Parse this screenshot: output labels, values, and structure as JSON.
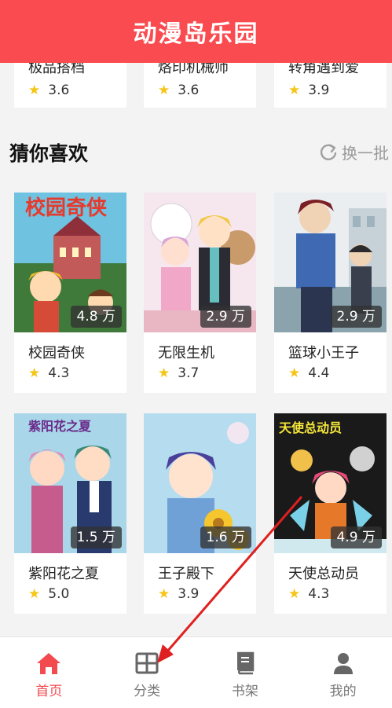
{
  "header": {
    "title": "动漫岛乐园"
  },
  "top_row": [
    {
      "name": "极品搭档",
      "rating": "3.6"
    },
    {
      "name": "烙印机械师",
      "rating": "3.6"
    },
    {
      "name": "转角遇到爱",
      "rating": "3.9"
    }
  ],
  "section": {
    "title": "猜你喜欢",
    "refresh_label": "换一批"
  },
  "comics": [
    {
      "name": "校园奇侠",
      "rating": "4.3",
      "views": "4.8 万"
    },
    {
      "name": "无限生机",
      "rating": "3.7",
      "views": "2.9 万"
    },
    {
      "name": "篮球小王子",
      "rating": "4.4",
      "views": "2.9 万"
    },
    {
      "name": "紫阳花之夏",
      "rating": "5.0",
      "views": "1.5 万"
    },
    {
      "name": "王子殿下",
      "rating": "3.9",
      "views": "1.6 万"
    },
    {
      "name": "天使总动员",
      "rating": "4.3",
      "views": "4.9 万"
    }
  ],
  "nav": {
    "home": "首页",
    "category": "分类",
    "bookshelf": "书架",
    "mine": "我的"
  },
  "colors": {
    "brand": "#fa4b50",
    "active": "#f24a4f",
    "star": "#f5c518",
    "annotation": "#e02020"
  }
}
